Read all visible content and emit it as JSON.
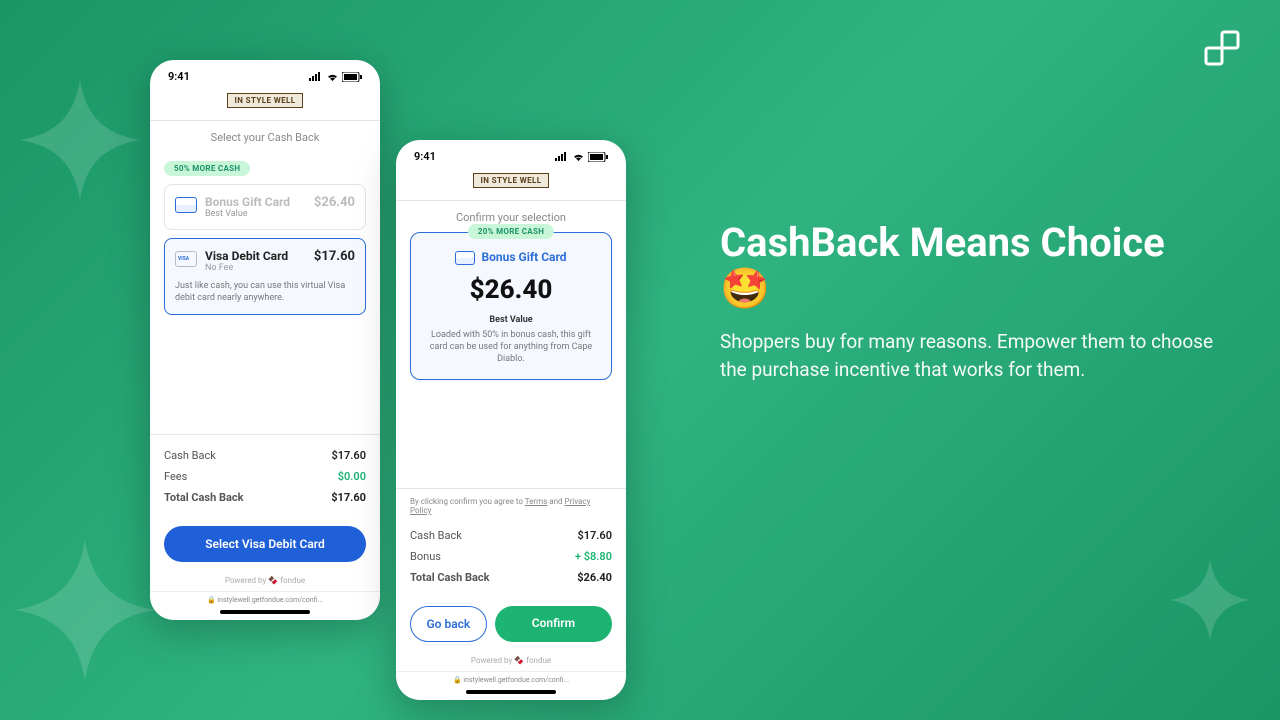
{
  "brand": "IN STYLE WELL",
  "status": {
    "time": "9:41"
  },
  "phone1": {
    "section_title": "Select your Cash Back",
    "badge": "50% MORE CASH",
    "option1": {
      "title": "Bonus Gift Card",
      "sub": "Best Value",
      "price": "$26.40"
    },
    "option2": {
      "title": "Visa Debit Card",
      "sub": "No Fee",
      "price": "$17.60",
      "desc": "Just like cash, you can use this virtual Visa debit card nearly anywhere."
    },
    "summary": {
      "cashback_label": "Cash Back",
      "cashback_val": "$17.60",
      "fees_label": "Fees",
      "fees_val": "$0.00",
      "total_label": "Total Cash Back",
      "total_val": "$17.60"
    },
    "cta": "Select Visa Debit Card",
    "powered": "Powered by 🍫 fondue",
    "url": "🔒 instylewell.getfondue.com/confi..."
  },
  "phone2": {
    "section_title": "Confirm your selection",
    "badge": "20% MORE CASH",
    "confirm": {
      "title": "Bonus Gift Card",
      "amount": "$26.40",
      "sub": "Best Value",
      "desc": "Loaded with 50% in bonus cash, this gift card can be used for anything from Cape Diablo."
    },
    "disclaimer": {
      "prefix": "By clicking confirm you agree to ",
      "terms": "Terms",
      "mid": " and ",
      "privacy": "Privacy Policy"
    },
    "summary": {
      "cashback_label": "Cash Back",
      "cashback_val": "$17.60",
      "bonus_label": "Bonus",
      "bonus_val": "+ $8.80",
      "total_label": "Total Cash Back",
      "total_val": "$26.40"
    },
    "back_btn": "Go back",
    "confirm_btn": "Confirm",
    "powered": "Powered by 🍫 fondue",
    "url": "🔒 instylewell.getfondue.com/confi..."
  },
  "marketing": {
    "headline": "CashBack Means Choice 🤩",
    "body": "Shoppers buy for many reasons. Empower them to choose the purchase incentive that works for them."
  }
}
